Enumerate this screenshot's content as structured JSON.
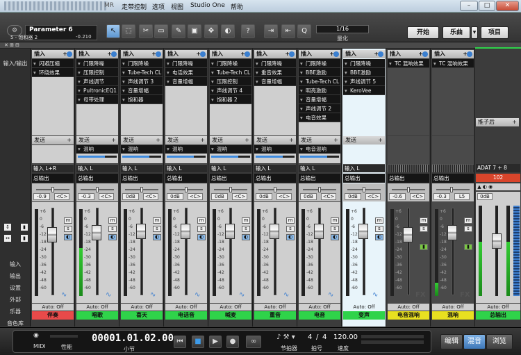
{
  "window": {
    "title_partial": "MR",
    "minimize": "–",
    "maximize": "□",
    "close": "✕"
  },
  "menu": [
    "走带控制",
    "选项",
    "视图",
    "Studio One",
    "帮助"
  ],
  "parameter": {
    "name": "Parameter 6",
    "track": "5 - 饱和器 2",
    "value": "-0.210"
  },
  "position_display": {
    "value": "1/16",
    "label": "量化"
  },
  "nav_buttons": {
    "start": "开始",
    "song": "乐曲",
    "project": "项目"
  },
  "left_nav": {
    "io": "输入/输出",
    "items": [
      "输入",
      "输出",
      "设置",
      "外部",
      "乐器",
      "音色库"
    ]
  },
  "strips": [
    {
      "name": "伴奏",
      "color": "#e84a4a",
      "inserts": [
        "闪避压缩",
        "环绕效果"
      ],
      "send": "",
      "input": "输入 L+R",
      "output": "总输出",
      "volume": "-0.9",
      "pan": "<C>",
      "fader": 0.78,
      "meter": 0,
      "auto": "Auto: Off"
    },
    {
      "name": "唱歌",
      "color": "#2fd34a",
      "inserts": [
        "门限降噪",
        "压限控制",
        "声线调节",
        "PultronicEQ1",
        "母带处理"
      ],
      "send": "混响",
      "input": "输入 L",
      "output": "总输出",
      "volume": "-0.3",
      "pan": "<C>",
      "fader": 0.8,
      "meter": 0.55,
      "auto": "Auto: Off"
    },
    {
      "name": "喜天",
      "color": "#2fd34a",
      "inserts": [
        "门限降噪",
        "Tube-Tech CL",
        "声线调节 3",
        "音量增幅",
        "饱和器"
      ],
      "send": "混响",
      "input": "输入 L",
      "output": "总输出",
      "volume": "0dB",
      "pan": "<C>",
      "fader": 0.82,
      "meter": 0,
      "auto": "Auto: Off"
    },
    {
      "name": "电话音",
      "color": "#2fd34a",
      "inserts": [
        "门限降噪",
        "电话效果",
        "音量增幅"
      ],
      "send": "混响",
      "input": "输入 L",
      "output": "总输出",
      "volume": "0dB",
      "pan": "<C>",
      "fader": 0.82,
      "meter": 0,
      "auto": "Auto: Off"
    },
    {
      "name": "喊麦",
      "color": "#2fd34a",
      "inserts": [
        "门限降噪",
        "Tube-Tech CL",
        "压限控制",
        "声线调节 4",
        "饱和器 2"
      ],
      "send": "混响",
      "input": "输入 L",
      "output": "总输出",
      "volume": "0dB",
      "pan": "<C>",
      "fader": 0.82,
      "meter": 0,
      "auto": "Auto: Off"
    },
    {
      "name": "重音",
      "color": "#2fd34a",
      "inserts": [
        "门限降噪",
        "重音效果",
        "音量增幅"
      ],
      "send": "混响",
      "input": "输入 L",
      "output": "总输出",
      "volume": "0dB",
      "pan": "<C>",
      "fader": 0.82,
      "meter": 0,
      "auto": "Auto: Off"
    },
    {
      "name": "电音",
      "color": "#2fd34a",
      "inserts": [
        "门限降噪",
        "BBE激励",
        "Tube-Tech CL",
        "明亮激励",
        "音量增幅",
        "声线调节 2",
        "电音效果"
      ],
      "send": "电音混响",
      "input": "输入 L",
      "output": "总输出",
      "volume": "0dB",
      "pan": "<C>",
      "fader": 0.82,
      "meter": 0,
      "auto": "Auto: Off"
    },
    {
      "name": "变声",
      "color": "#2fd34a",
      "inserts": [
        "门限降噪",
        "BBE激励",
        "声线调节 5",
        "KeroVee"
      ],
      "send": "",
      "input": "输入 L",
      "output": "总输出",
      "volume": "0dB",
      "pan": "<C>",
      "fader": 0.82,
      "meter": 0,
      "auto": "Auto: Off",
      "highlight": true
    },
    {
      "name": "电音混响",
      "color": "#e8e020",
      "inserts": [
        "TC 混响效果"
      ],
      "send": "",
      "input": "",
      "output": "总输出",
      "volume": "-0.6",
      "pan": "<C>",
      "fader": 0.78,
      "meter": 0,
      "auto": "Auto: Off",
      "fx": true
    },
    {
      "name": "混响",
      "color": "#e8e020",
      "inserts": [
        "TC 混响效果"
      ],
      "send": "",
      "input": "",
      "output": "总输出",
      "volume": "-0.3",
      "pan": "L5",
      "fader": 0.8,
      "meter": 0.15,
      "auto": "Auto: Off",
      "fx": true
    }
  ],
  "master": {
    "name": "总输出",
    "post": "推子后",
    "input": "ADAT 7 + 8",
    "level": "102",
    "volume": "0dB",
    "auto": "Auto: Off",
    "meter": 0.6
  },
  "strip_labels": {
    "insert": "插入",
    "send": "发送",
    "plus": "+",
    "mute": "m",
    "solo": "s"
  },
  "scale_marks": [
    "+6",
    "0",
    "-6",
    "-12",
    "-18",
    "-24",
    "-30",
    "-36",
    "-42",
    "-48",
    "-60"
  ],
  "transport": {
    "midi": "MIDI",
    "performance": "性能",
    "time": "00001.01.02.00",
    "time_unit": "小节",
    "metronome": "节拍器",
    "sig_top": "4",
    "sig_bottom": "4",
    "sig_label": "拍号",
    "tempo": "120.00",
    "tempo_label": "速度"
  },
  "views": [
    "编辑",
    "混音",
    "浏览"
  ],
  "active_view": "混音"
}
